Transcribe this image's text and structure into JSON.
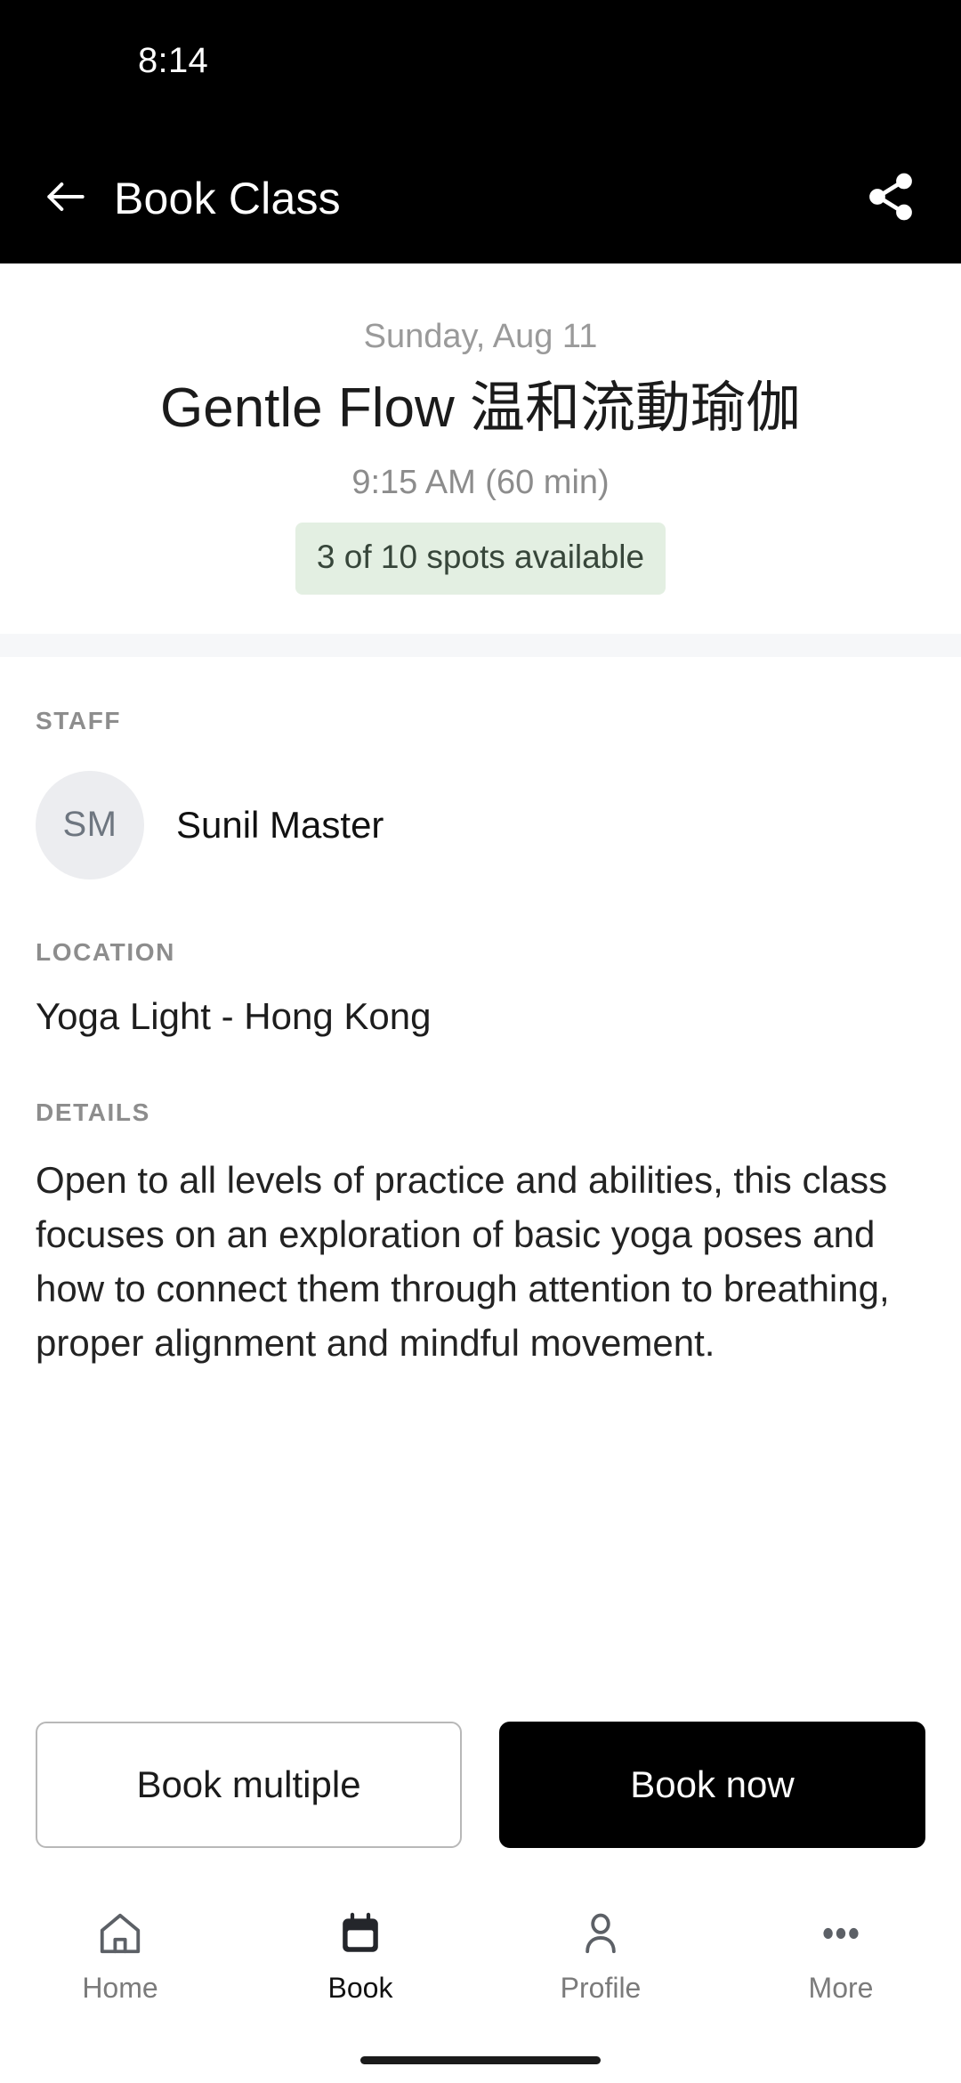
{
  "status_bar": {
    "time": "8:14"
  },
  "app_bar": {
    "title": "Book Class",
    "back_icon": "arrow-left-icon",
    "share_icon": "share-icon"
  },
  "class_header": {
    "date": "Sunday, Aug 11",
    "title": "Gentle Flow 温和流動瑜伽",
    "time": "9:15 AM (60 min)",
    "spots_badge": "3 of 10 spots available",
    "spots_badge_bg": "#e3efe2",
    "spots_badge_color": "#37463a"
  },
  "sections": {
    "staff_label": "STAFF",
    "staff_initials": "SM",
    "staff_name": "Sunil Master",
    "location_label": "LOCATION",
    "location_value": "Yoga Light - Hong Kong",
    "details_label": "DETAILS",
    "details_text": "Open to all levels of practice and abilities, this class focuses on an exploration of basic yoga poses and how to connect them through attention to breathing, proper alignment and mindful movement."
  },
  "actions": {
    "secondary_label": "Book multiple",
    "primary_label": "Book now",
    "primary_bg": "#000000",
    "primary_color": "#ffffff"
  },
  "bottom_nav": {
    "items": [
      {
        "label": "Home",
        "icon": "home-icon",
        "active": false
      },
      {
        "label": "Book",
        "icon": "calendar-icon",
        "active": true
      },
      {
        "label": "Profile",
        "icon": "person-icon",
        "active": false
      },
      {
        "label": "More",
        "icon": "more-dots-icon",
        "active": false
      }
    ]
  }
}
